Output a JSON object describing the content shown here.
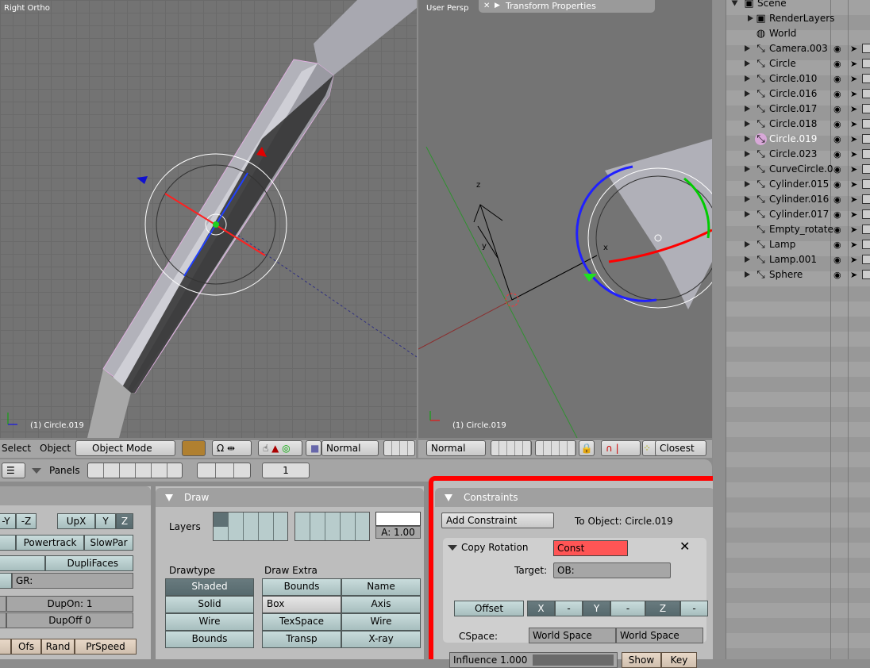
{
  "viewports": {
    "left": {
      "view_label": "Right Ortho",
      "object_label": "(1) Circle.019"
    },
    "right": {
      "view_label": "User Persp",
      "object_label": "(1) Circle.019",
      "floating_panel": "Transform Properties",
      "axis_z": "z",
      "axis_y": "y",
      "axis_x": "x"
    }
  },
  "view3d_header": {
    "select_menu": "Select",
    "object_menu": "Object",
    "mode": "Object Mode",
    "draw_mode_icon": "object-cube-icon",
    "pivot_icon": "pivot-icon",
    "manip_icons": [
      "hand-icon",
      "cone-icon",
      "ring-icon",
      "box-icon"
    ],
    "orientation_left": "Normal",
    "orientation_right": "Normal",
    "snap": "Closest"
  },
  "buttons_header": {
    "panels_label": "Panels",
    "frame": "1"
  },
  "object_panel": {
    "buttons": [
      "-Y",
      "-Z",
      "UpX",
      "Y",
      "Z",
      "Powertrack",
      "SlowPar",
      "DupliFaces",
      "GR:",
      "DupOn: 1",
      "DupOff 0",
      "Ofs",
      "Rand",
      "PrSpeed"
    ]
  },
  "draw_panel": {
    "title": "Draw",
    "layers_label": "Layers",
    "alpha": "A: 1.00",
    "drawtype_label": "Drawtype",
    "drawtype": [
      "Shaded",
      "Solid",
      "Wire",
      "Bounds"
    ],
    "drawextra_label": "Draw Extra",
    "drawextra_left": [
      "Bounds",
      "Box",
      "TexSpace",
      "Transp"
    ],
    "drawextra_right": [
      "Name",
      "Axis",
      "Wire",
      "X-ray"
    ]
  },
  "constraints_panel": {
    "title": "Constraints",
    "add_button": "Add Constraint",
    "to_object": "To Object: Circle.019",
    "constraint": {
      "type": "Copy Rotation",
      "name": "Const",
      "target_label": "Target:",
      "target_value": "OB:",
      "offset": "Offset",
      "axes": [
        "X",
        "-",
        "Y",
        "-",
        "Z",
        "-"
      ],
      "cspace_label": "CSpace:",
      "cspace_owner": "World Space",
      "cspace_target": "World Space",
      "influence": "Influence 1.000",
      "influence_value": 1.0,
      "show": "Show",
      "key": "Key"
    },
    "highlight_color": "#ff0000",
    "name_color": "#ff5555"
  },
  "outliner": {
    "items": [
      {
        "name": "Scene",
        "icon": "scene-icon",
        "depth": 0
      },
      {
        "name": "RenderLayers",
        "icon": "renderlayers-icon",
        "depth": 1
      },
      {
        "name": "World",
        "icon": "world-icon",
        "depth": 1
      },
      {
        "name": "Camera.003",
        "icon": "object-icon",
        "depth": 1
      },
      {
        "name": "Circle",
        "icon": "object-icon",
        "depth": 1
      },
      {
        "name": "Circle.010",
        "icon": "object-icon",
        "depth": 1
      },
      {
        "name": "Circle.016",
        "icon": "object-icon",
        "depth": 1
      },
      {
        "name": "Circle.017",
        "icon": "object-icon",
        "depth": 1
      },
      {
        "name": "Circle.018",
        "icon": "object-icon",
        "depth": 1
      },
      {
        "name": "Circle.019",
        "icon": "object-icon",
        "depth": 1,
        "selected": true
      },
      {
        "name": "Circle.023",
        "icon": "object-icon",
        "depth": 1
      },
      {
        "name": "CurveCircle.0",
        "icon": "object-icon",
        "depth": 1
      },
      {
        "name": "Cylinder.015",
        "icon": "object-icon",
        "depth": 1
      },
      {
        "name": "Cylinder.016",
        "icon": "object-icon",
        "depth": 1
      },
      {
        "name": "Cylinder.017",
        "icon": "object-icon",
        "depth": 1
      },
      {
        "name": "Empty_rotate",
        "icon": "object-icon",
        "depth": 1
      },
      {
        "name": "Lamp",
        "icon": "object-icon",
        "depth": 1
      },
      {
        "name": "Lamp.001",
        "icon": "object-icon",
        "depth": 1
      },
      {
        "name": "Sphere",
        "icon": "object-icon",
        "depth": 1
      }
    ]
  }
}
